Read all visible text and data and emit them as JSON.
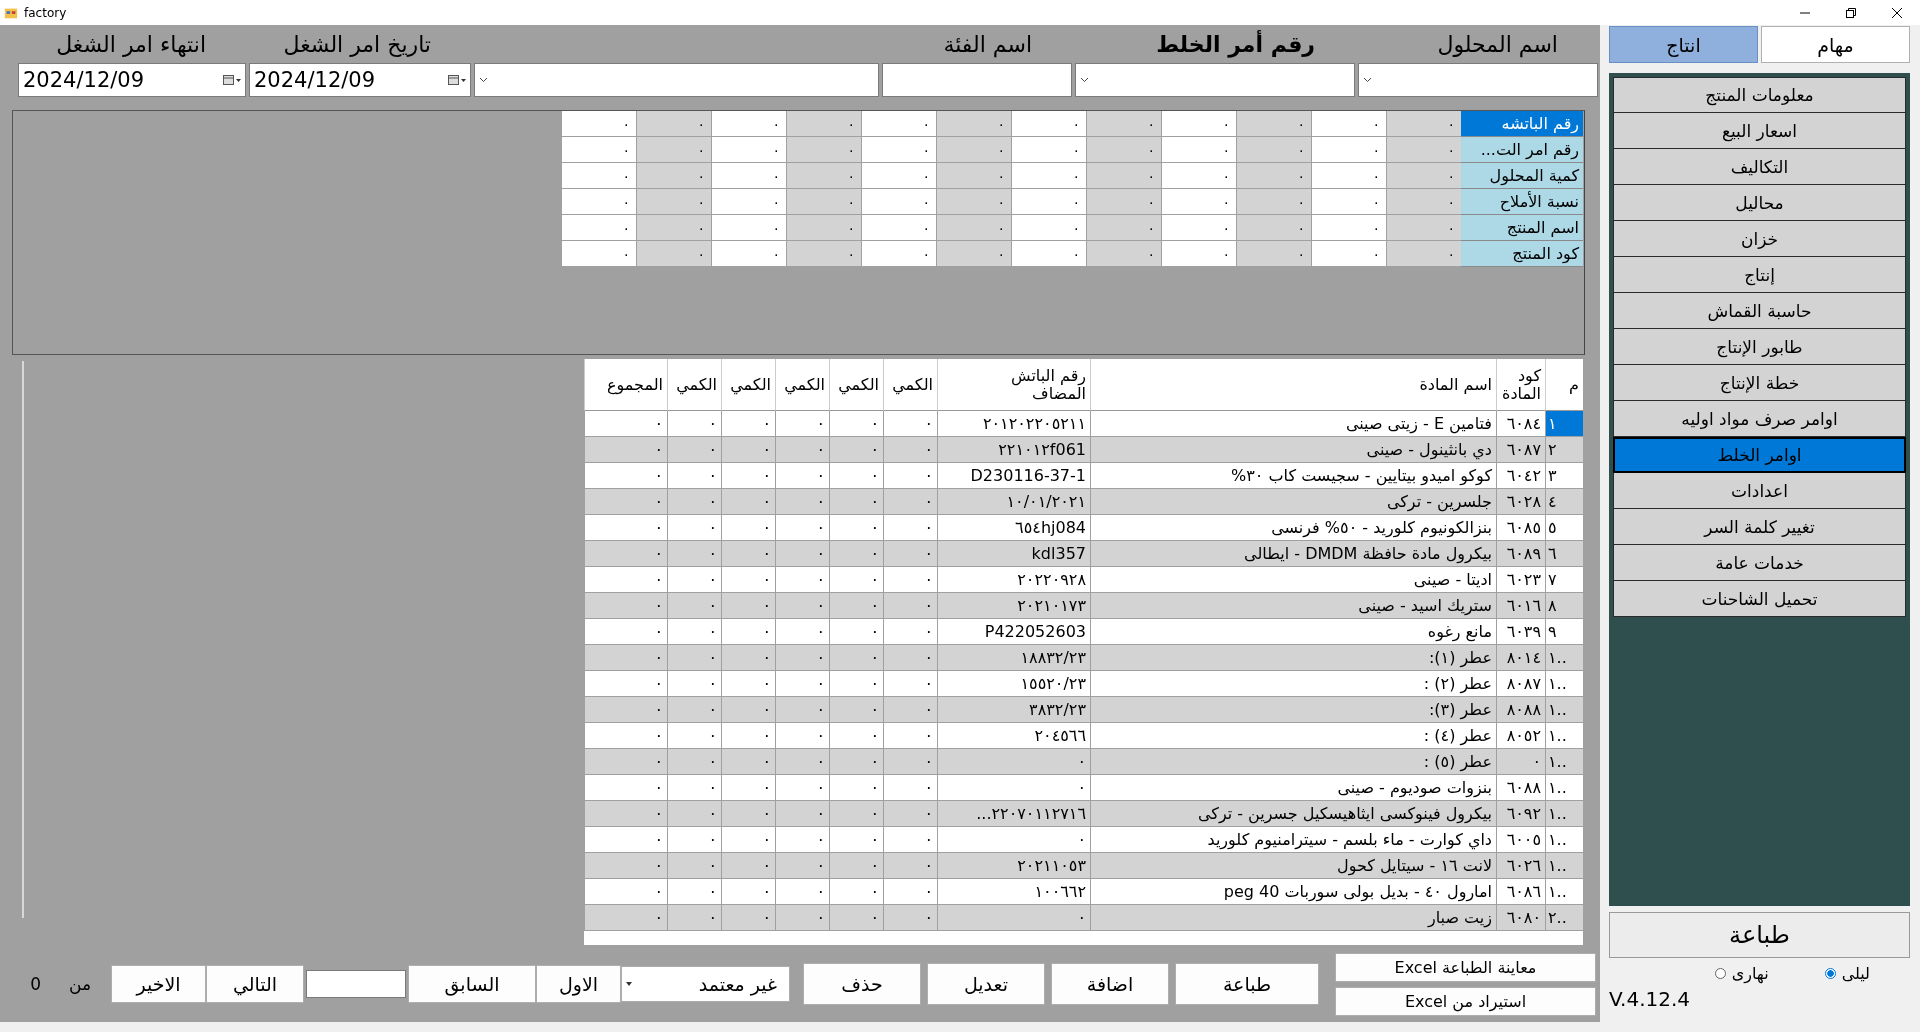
{
  "window": {
    "title": "factory"
  },
  "header_fields": [
    {
      "kind": "combo",
      "label": "اسم المحلول",
      "bold": false
    },
    {
      "kind": "combo",
      "label": "رقم أمر الخلط",
      "bold": true
    },
    {
      "kind": "text",
      "label": "اسم الفئة",
      "bold": false
    },
    {
      "kind": "combo"
    },
    {
      "kind": "date",
      "label": "تاريخ امر الشغل",
      "bold": false,
      "value": "2024/12/09"
    },
    {
      "kind": "date",
      "label": "انتهاء امر الشغل",
      "bold": false,
      "value": "2024/12/09"
    }
  ],
  "batch_grid": {
    "rows": [
      {
        "label": "رقم الباتشه",
        "selected": true,
        "cells": [
          "٠",
          "٠",
          "٠",
          "٠",
          "٠",
          "٠",
          "٠",
          "٠",
          "٠",
          "٠",
          "٠",
          "٠"
        ]
      },
      {
        "label": "رقم امر الت...",
        "selected": false,
        "cells": [
          "٠",
          "٠",
          "٠",
          "٠",
          "٠",
          "٠",
          "٠",
          "٠",
          "٠",
          "٠",
          "٠",
          "٠"
        ]
      },
      {
        "label": "كمية المحلول",
        "selected": false,
        "cells": [
          "٠",
          "٠",
          "٠",
          "٠",
          "٠",
          "٠",
          "٠",
          "٠",
          "٠",
          "٠",
          "٠",
          "٠"
        ]
      },
      {
        "label": "نسبة الأملاح",
        "selected": false,
        "cells": [
          "٠",
          "٠",
          "٠",
          "٠",
          "٠",
          "٠",
          "٠",
          "٠",
          "٠",
          "٠",
          "٠",
          "٠"
        ]
      },
      {
        "label": "اسم المنتج",
        "selected": false,
        "cells": [
          "٠",
          "٠",
          "٠",
          "٠",
          "٠",
          "٠",
          "٠",
          "٠",
          "٠",
          "٠",
          "٠",
          "٠"
        ]
      },
      {
        "label": "كود المنتج",
        "selected": false,
        "cells": [
          "٠",
          "٠",
          "٠",
          "٠",
          "٠",
          "٠",
          "٠",
          "٠",
          "٠",
          "٠",
          "٠",
          "٠"
        ]
      }
    ]
  },
  "materials_table": {
    "columns": [
      "م",
      "كود المادة",
      "اسم المادة",
      "رقم الباتش المضاف",
      "الكمي",
      "الكمي",
      "الكمي",
      "الكمي",
      "الكمي",
      "المجموع"
    ],
    "rows": [
      {
        "index": "١",
        "selected": true,
        "code": "٦٠٨٤",
        "name": "فتامين E - زيتى صينى",
        "batch": "٢٠١٢٠٢٢٠٥٢١١",
        "quantities": [
          "٠",
          "٠",
          "٠",
          "٠",
          "٠"
        ],
        "total": "٠"
      },
      {
        "index": "٢",
        "selected": false,
        "code": "٦٠٨٧",
        "name": "دي بانثينول - صينى",
        "batch": "٢٢١٠١٢f061",
        "quantities": [
          "٠",
          "٠",
          "٠",
          "٠",
          "٠"
        ],
        "total": "٠"
      },
      {
        "index": "٣",
        "selected": false,
        "code": "٦٠٤٢",
        "name": "كوكو اميدو بيتايين - سجيست كاب ٣٠%",
        "batch": "D230116-37-1",
        "quantities": [
          "٠",
          "٠",
          "٠",
          "٠",
          "٠"
        ],
        "total": "٠"
      },
      {
        "index": "٤",
        "selected": false,
        "code": "٦٠٢٨",
        "name": "جلسرين - تركى",
        "batch": "١٠/٠١/٢٠٢١",
        "quantities": [
          "٠",
          "٠",
          "٠",
          "٠",
          "٠"
        ],
        "total": "٠"
      },
      {
        "index": "٥",
        "selected": false,
        "code": "٦٠٨٥",
        "name": "بنزالكونيوم كلوريد - ٥٠% فرنسى",
        "batch": "٦٥٤hj084",
        "quantities": [
          "٠",
          "٠",
          "٠",
          "٠",
          "٠"
        ],
        "total": "٠"
      },
      {
        "index": "٦",
        "selected": false,
        "code": "٦٠٨٩",
        "name": "بيكرول مادة حافظة DMDM - ايطالى",
        "batch": "kdl357",
        "quantities": [
          "٠",
          "٠",
          "٠",
          "٠",
          "٠"
        ],
        "total": "٠"
      },
      {
        "index": "٧",
        "selected": false,
        "code": "٦٠٢٣",
        "name": "اديتا - صينى",
        "batch": "٢٠٢٢٠٩٢٨",
        "quantities": [
          "٠",
          "٠",
          "٠",
          "٠",
          "٠"
        ],
        "total": "٠"
      },
      {
        "index": "٨",
        "selected": false,
        "code": "٦٠١٦",
        "name": "ستريك اسيد - صينى",
        "batch": "٢٠٢١٠١٧٣",
        "quantities": [
          "٠",
          "٠",
          "٠",
          "٠",
          "٠"
        ],
        "total": "٠"
      },
      {
        "index": "٩",
        "selected": false,
        "code": "٦٠٣٩",
        "name": "مانع رغوه",
        "batch": "P422052603",
        "quantities": [
          "٠",
          "٠",
          "٠",
          "٠",
          "٠"
        ],
        "total": "٠"
      },
      {
        "index": "١..",
        "selected": false,
        "code": "٨٠١٤",
        "name": "عطر (١):",
        "batch": "١٨٨٣٢/٢٣",
        "quantities": [
          "٠",
          "٠",
          "٠",
          "٠",
          "٠"
        ],
        "total": "٠"
      },
      {
        "index": "١..",
        "selected": false,
        "code": "٨٠٨٧",
        "name": "عطر (٢) :",
        "batch": "١٥٥٢٠/٢٣",
        "quantities": [
          "٠",
          "٠",
          "٠",
          "٠",
          "٠"
        ],
        "total": "٠"
      },
      {
        "index": "١..",
        "selected": false,
        "code": "٨٠٨٨",
        "name": "عطر (٣):",
        "batch": "٣٨٣٢/٢٣",
        "quantities": [
          "٠",
          "٠",
          "٠",
          "٠",
          "٠"
        ],
        "total": "٠"
      },
      {
        "index": "١..",
        "selected": false,
        "code": "٨٠٥٢",
        "name": "عطر (٤) :",
        "batch": "٢٠٤٥٦٦",
        "quantities": [
          "٠",
          "٠",
          "٠",
          "٠",
          "٠"
        ],
        "total": "٠"
      },
      {
        "index": "١..",
        "selected": false,
        "code": "٠",
        "name": "عطر (٥) :",
        "batch": "٠",
        "quantities": [
          "٠",
          "٠",
          "٠",
          "٠",
          "٠"
        ],
        "total": "٠"
      },
      {
        "index": "١..",
        "selected": false,
        "code": "٦٠٨٨",
        "name": "بنزوات صوديوم - صينى",
        "batch": "٠",
        "quantities": [
          "٠",
          "٠",
          "٠",
          "٠",
          "٠"
        ],
        "total": "٠"
      },
      {
        "index": "١..",
        "selected": false,
        "code": "٦٠٩٢",
        "name": "بيكرول فينوكسى ايثاهيسكيل جسرين - تركى",
        "batch": "٢٢٠٧٠١١٢٧١٦...",
        "quantities": [
          "٠",
          "٠",
          "٠",
          "٠",
          "٠"
        ],
        "total": "٠"
      },
      {
        "index": "١..",
        "selected": false,
        "code": "٦٠٠٥",
        "name": "داي كوارت - ماء بلسم - سيترامنيوم كلوريد",
        "batch": "٠",
        "quantities": [
          "٠",
          "٠",
          "٠",
          "٠",
          "٠"
        ],
        "total": "٠"
      },
      {
        "index": "١..",
        "selected": false,
        "code": "٦٠٢٦",
        "name": "لانت ١٦ - سيتايل كحول",
        "batch": "٢٠٢١١٠٥٣",
        "quantities": [
          "٠",
          "٠",
          "٠",
          "٠",
          "٠"
        ],
        "total": "٠"
      },
      {
        "index": "١..",
        "selected": false,
        "code": "٦٠٨٦",
        "name": "امارول ٤٠ - بديل بولى سوربات peg 40",
        "batch": "١٠٠٦٦٢",
        "quantities": [
          "٠",
          "٠",
          "٠",
          "٠",
          "٠"
        ],
        "total": "٠"
      },
      {
        "index": "٢..",
        "selected": false,
        "code": "٦٠٨٠",
        "name": "زيت صبار",
        "batch": "٠",
        "quantities": [
          "٠",
          "٠",
          "٠",
          "٠",
          "٠"
        ],
        "total": "٠"
      }
    ]
  },
  "excel_buttons": [
    "معاينة الطباعة Excel",
    "استيراد من Excel"
  ],
  "actions": [
    "طباعة",
    "اضافة",
    "تعديل",
    "حذف"
  ],
  "status_combo": {
    "value": "غير معتمد"
  },
  "pager": {
    "first": "الاول",
    "previous": "السابق",
    "next": "التالي",
    "last": "الاخير",
    "of_label": "من",
    "total": "0"
  },
  "side_tabs": [
    {
      "label": "مهام",
      "selected": false
    },
    {
      "label": "انتاج",
      "selected": true
    }
  ],
  "menu": [
    {
      "label": "معلومات المنتج",
      "selected": false
    },
    {
      "label": "اسعار البيع",
      "selected": false
    },
    {
      "label": "التكاليف",
      "selected": false
    },
    {
      "label": "محاليل",
      "selected": false
    },
    {
      "label": "خزان",
      "selected": false
    },
    {
      "label": "إنتاج",
      "selected": false
    },
    {
      "label": "حاسبة القماش",
      "selected": false
    },
    {
      "label": "طابور الإنتاج",
      "selected": false
    },
    {
      "label": "خطة الإنتاج",
      "selected": false
    },
    {
      "label": "اوامر صرف مواد اوليه",
      "selected": false
    },
    {
      "label": "اوامر الخلط",
      "selected": true
    },
    {
      "label": "اعدادات",
      "selected": false
    },
    {
      "label": "تغيير كلمة السر",
      "selected": false
    },
    {
      "label": "خدمات عامة",
      "selected": false
    },
    {
      "label": "تحميل الشاحنات",
      "selected": false
    }
  ],
  "print_button": "طباعة",
  "theme_options": [
    {
      "label": "ليلى",
      "selected": true
    },
    {
      "label": "نهارى",
      "selected": false
    }
  ],
  "version": "V.4.12.4"
}
